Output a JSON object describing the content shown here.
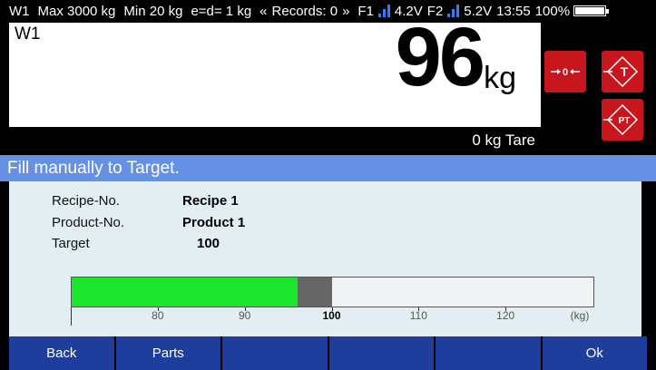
{
  "status": {
    "scale": "W1",
    "max": "Max 3000 kg",
    "min": "Min 20 kg",
    "division": "e=d= 1 kg",
    "records_prev": "«",
    "records": "Records: 0",
    "records_next": "»",
    "f1_label": "F1",
    "f1_voltage": "4.2V",
    "f2_label": "F2",
    "f2_voltage": "5.2V",
    "time": "13:55",
    "battery": "100%"
  },
  "display": {
    "scale_id": "W1",
    "weight": "96",
    "unit": "kg",
    "tare": "0 kg Tare"
  },
  "function_buttons": {
    "zero": "0",
    "tare": "T",
    "preset_tare": "PT"
  },
  "banner": "Fill manually to Target.",
  "info": {
    "recipe_label": "Recipe-No.",
    "recipe_value": "Recipe 1",
    "product_label": "Product-No.",
    "product_value": "Product 1",
    "target_label": "Target",
    "target_value": "100"
  },
  "fill_bar": {
    "range": [
      70,
      130
    ],
    "current": 96,
    "target_band": [
      96,
      100
    ],
    "ticks": [
      "80",
      "90",
      "100",
      "110",
      "120"
    ],
    "unit_label": "(kg)",
    "fill_color": "#1be52c",
    "target_color": "#666666"
  },
  "softkeys": [
    "Back",
    "Parts",
    "",
    "",
    "",
    "Ok"
  ],
  "colors": {
    "banner": "#6690e4",
    "softkey": "#1f3d9c",
    "function_button": "#c8161e",
    "panel": "#e2eef1"
  }
}
